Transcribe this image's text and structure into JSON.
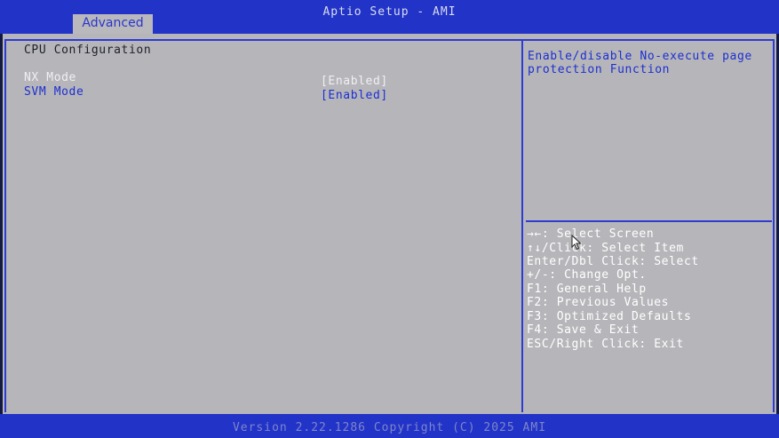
{
  "header": {
    "title": "Aptio Setup - AMI",
    "active_tab": "Advanced"
  },
  "page": {
    "title": "CPU Configuration"
  },
  "settings": [
    {
      "label": "NX Mode",
      "value": "[Enabled]"
    },
    {
      "label": "SVM Mode",
      "value": "[Enabled]"
    }
  ],
  "help": {
    "line1": "Enable/disable No-execute page",
    "line2": "protection Function"
  },
  "keys": [
    {
      "glyph": "→←",
      "text": ": Select Screen"
    },
    {
      "glyph": "↑↓",
      "text": "/Click: Select Item"
    },
    {
      "glyph": "",
      "text": "Enter/Dbl Click: Select"
    },
    {
      "glyph": "",
      "text": "+/-: Change Opt."
    },
    {
      "glyph": "",
      "text": "F1: General Help"
    },
    {
      "glyph": "",
      "text": "F2: Previous Values"
    },
    {
      "glyph": "",
      "text": "F3: Optimized Defaults"
    },
    {
      "glyph": "",
      "text": "F4: Save & Exit"
    },
    {
      "glyph": "",
      "text": "ESC/Right Click: Exit"
    }
  ],
  "footer": {
    "text": "Version 2.22.1286 Copyright (C) 2025 AMI"
  },
  "colors": {
    "header_blue": "#2233c8",
    "panel_grey": "#b6b6ba",
    "highlight_blue": "#1d2fd0",
    "key_text": "#ffffff"
  },
  "icons": {
    "cursor": "mouse-pointer-icon"
  }
}
